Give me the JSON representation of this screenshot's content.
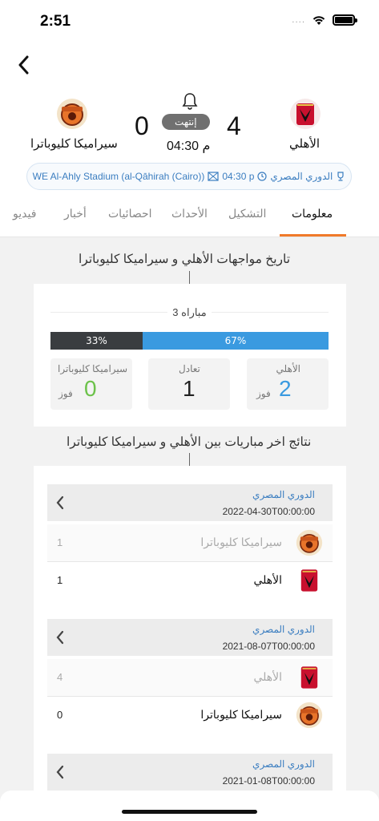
{
  "status_bar": {
    "time": "2:51",
    "signal": "....",
    "icons": [
      "wifi-icon",
      "battery-icon"
    ]
  },
  "match": {
    "home_team": "الأهلي",
    "away_team": "سيراميكا كليوباترا",
    "home_score": "4",
    "away_score": "0",
    "status": "إنتهت",
    "kickoff": "04:30 م"
  },
  "info": {
    "league": "الدوري المصري",
    "time": "04:30 p",
    "stadium": "WE Al-Ahly Stadium (al-Qāhirah (Cairo))"
  },
  "tabs": [
    {
      "label": "معلومات",
      "active": true
    },
    {
      "label": "التشكيل"
    },
    {
      "label": "الأحداث"
    },
    {
      "label": "احصائيات"
    },
    {
      "label": "أخبار"
    },
    {
      "label": "فيديو"
    }
  ],
  "h2h": {
    "title": "تاريخ مواجهات الأهلي و سيراميكا كليوباترا",
    "matches_count": "3 مباراه",
    "away_pct": "33%",
    "home_pct": "67%",
    "home_share": 0.67,
    "home_label": "الأهلي",
    "home_wins": "2",
    "draw_label": "تعادل",
    "draws": "1",
    "away_label": "سيراميكا كليوباترا",
    "away_wins": "0",
    "win_label": "فوز"
  },
  "recent": {
    "title": "نتائج اخر مباريات بين الأهلي و سيراميكا كليوباترا",
    "matches": [
      {
        "league": "الدوري المصري",
        "date": "2022-04-30T00:00:00",
        "rows": [
          {
            "team": "سيراميكا كليوباترا",
            "score": "1",
            "dim": true,
            "logo": "ceramica-logo"
          },
          {
            "team": "الأهلي",
            "score": "1",
            "dim": false,
            "logo": "ahly-logo"
          }
        ]
      },
      {
        "league": "الدوري المصري",
        "date": "2021-08-07T00:00:00",
        "rows": [
          {
            "team": "الأهلي",
            "score": "4",
            "dim": true,
            "logo": "ahly-logo"
          },
          {
            "team": "سيراميكا كليوباترا",
            "score": "0",
            "dim": false,
            "logo": "ceramica-logo"
          }
        ]
      },
      {
        "league": "الدوري المصري",
        "date": "2021-01-08T00:00:00",
        "rows": []
      }
    ]
  },
  "colors": {
    "accent": "#f07a2a",
    "blue": "#3a9ae0",
    "dark": "#3a3d40",
    "link": "#3a7dc0",
    "win_green": "#6cc24a"
  }
}
